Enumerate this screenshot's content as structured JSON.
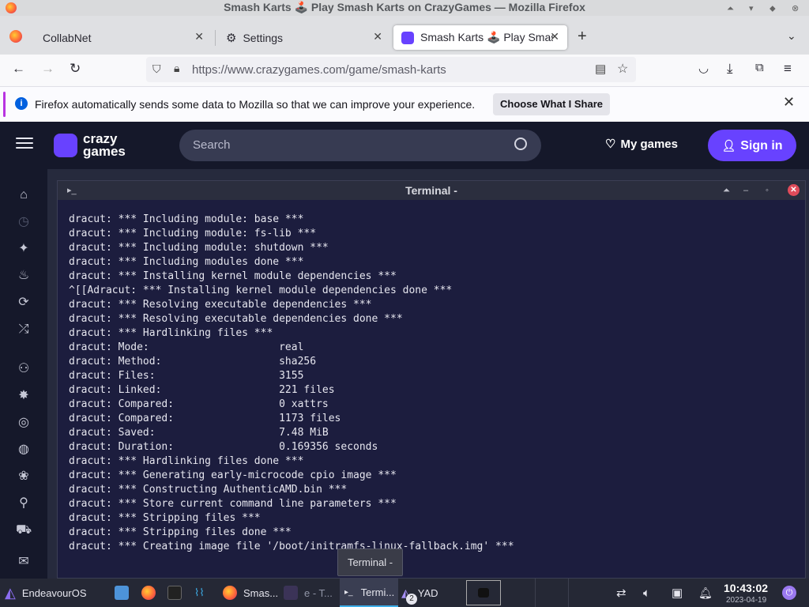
{
  "window": {
    "title": "Smash Karts 🕹️ Play Smash Karts on CrazyGames — Mozilla Firefox"
  },
  "tabs": [
    {
      "label": "CollabNet"
    },
    {
      "label": "Settings"
    },
    {
      "label": "Smash Karts 🕹️ Play Smash"
    }
  ],
  "nav": {
    "url": "https://www.crazygames.com/game/smash-karts"
  },
  "notification": {
    "message": "Firefox automatically sends some data to Mozilla so that we can improve your experience.",
    "button": "Choose What I Share"
  },
  "site": {
    "logo_line1": "crazy",
    "logo_line2": "games",
    "search_placeholder": "Search",
    "my_games": "My games",
    "sign_in": "Sign in"
  },
  "terminal": {
    "title": "Terminal -",
    "lines": [
      "dracut: *** Including module: base ***",
      "dracut: *** Including module: fs-lib ***",
      "dracut: *** Including module: shutdown ***",
      "dracut: *** Including modules done ***",
      "dracut: *** Installing kernel module dependencies ***",
      "^[[Adracut: *** Installing kernel module dependencies done ***",
      "dracut: *** Resolving executable dependencies ***",
      "dracut: *** Resolving executable dependencies done ***",
      "dracut: *** Hardlinking files ***",
      "dracut: Mode:                     real",
      "dracut: Method:                   sha256",
      "dracut: Files:                    3155",
      "dracut: Linked:                   221 files",
      "dracut: Compared:                 0 xattrs",
      "dracut: Compared:                 1173 files",
      "dracut: Saved:                    7.48 MiB",
      "dracut: Duration:                 0.169356 seconds",
      "dracut: *** Hardlinking files done ***",
      "dracut: *** Generating early-microcode cpio image ***",
      "dracut: *** Constructing AuthenticAMD.bin ***",
      "dracut: *** Store current command line parameters ***",
      "dracut: *** Stripping files ***",
      "dracut: *** Stripping files done ***",
      "dracut: *** Creating image file '/boot/initramfs-linux-fallback.img' ***"
    ]
  },
  "tooltip": "Terminal -",
  "taskbar": {
    "start": "EndeavourOS",
    "items": [
      {
        "label": "Smas..."
      },
      {
        "label": "e - T..."
      },
      {
        "label": "Termi..."
      },
      {
        "label": "YAD"
      }
    ],
    "badge": "2",
    "time": "10:43:02",
    "date": "2023-04-19"
  },
  "colors": {
    "accent": "#6842ff",
    "terminal_bg": "#1c1d3e",
    "taskbar_bg": "#252835"
  }
}
